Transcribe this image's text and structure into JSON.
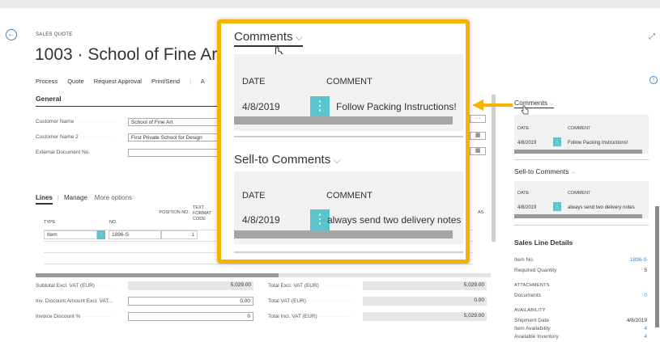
{
  "page": {
    "caption": "SALES QUOTE",
    "title": "1003 · School of Fine Art"
  },
  "actions": [
    "Process",
    "Quote",
    "Request Approval",
    "Print/Send",
    "A"
  ],
  "general": {
    "heading": "General",
    "fields": [
      {
        "label": "Customer Name",
        "value": "School of Fine Art"
      },
      {
        "label": "Customer Name 2",
        "value": "First Private School for Design"
      },
      {
        "label": "External Document No.",
        "value": ""
      }
    ]
  },
  "lines": {
    "tab": "Lines",
    "manage": "Manage",
    "more": "More options",
    "columns": {
      "type": "TYPE",
      "no": "NO.",
      "position": "POSITION NO.",
      "text_format": "TEXT FORMAT CODE",
      "as": "AS"
    },
    "rows": [
      {
        "type": "Item",
        "no": "1896-S",
        "position": "1"
      }
    ]
  },
  "totals": {
    "left": [
      {
        "label": "Subtotal Excl. VAT (EUR)",
        "value": "5,029.00"
      },
      {
        "label": "Inv. Discount Amount Excl. VAT...",
        "value": "0.00"
      },
      {
        "label": "Invoice Discount %",
        "value": "0"
      }
    ],
    "right": [
      {
        "label": "Total Excl. VAT (EUR)",
        "value": "5,029.00"
      },
      {
        "label": "Total VAT (EUR)",
        "value": "0.00"
      },
      {
        "label": "Total Incl. VAT (EUR)",
        "value": "5,029.00"
      }
    ]
  },
  "factbox": {
    "comments_title": "Comments",
    "sell_to_title": "Sell-to Comments",
    "col_date": "DATE",
    "col_comment": "COMMENT",
    "comments": [
      {
        "date": "4/8/2019",
        "comment": "Follow Packing Instructions!"
      }
    ],
    "sell_to": [
      {
        "date": "4/8/2019",
        "comment": "always send two delivery notes"
      }
    ],
    "sales_line_details": {
      "title": "Sales Line Details",
      "item_no_label": "Item No.",
      "item_no": "1896-S",
      "required_qty_label": "Required Quantity",
      "required_qty": "5",
      "attachments_cap": "ATTACHMENTS",
      "documents_label": "Documents",
      "documents": "0",
      "availability_cap": "AVAILABILITY",
      "shipment_date_label": "Shipment Date",
      "shipment_date": "4/8/2019",
      "item_availability_label": "Item Availability",
      "item_availability": "4",
      "available_inventory_label": "Available Inventory",
      "available_inventory": "4"
    }
  },
  "zoom": {
    "comments_title": "Comments",
    "sell_to_title": "Sell-to Comments",
    "col_date": "DATE",
    "col_comment": "COMMENT",
    "comments": [
      {
        "date": "4/8/2019",
        "comment": "Follow Packing Instructions!"
      }
    ],
    "sell_to": [
      {
        "date": "4/8/2019",
        "comment": "always send two delivery notes"
      }
    ]
  },
  "colors": {
    "accent": "#3a8ac8",
    "tile": "#5bc4cc",
    "highlight": "#f4b400"
  },
  "icons": [
    "back-arrow-icon",
    "expand-icon",
    "info-icon",
    "dropdown-chevron-icon",
    "hand-cursor-icon",
    "actions-dots-icon",
    "calendar-icon",
    "lookup-ellipsis-icon"
  ]
}
